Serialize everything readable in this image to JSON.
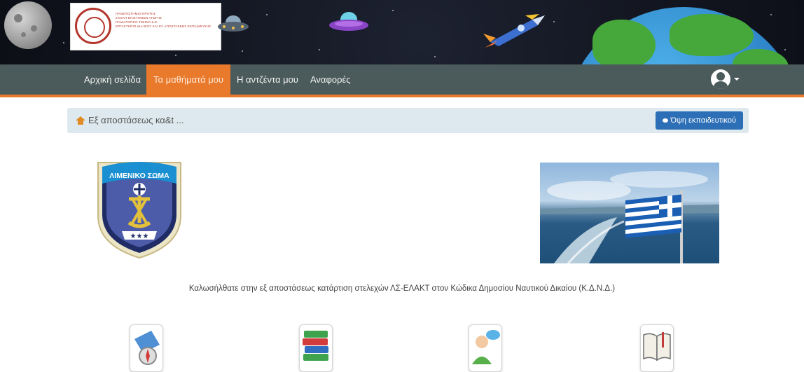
{
  "header": {
    "university_lines": [
      "ΠΑΝΕΠΙΣΤΗΜΙΟ ΚΡΗΤΗΣ",
      "ΣΧΟΛΗ ΕΠΙΣΤΗΜΩΝ ΑΓΩΓΗΣ",
      "ΠΑΙΔΑΓΩΓΙΚΟ ΤΜΗΜΑ Δ.Ε.",
      "ΕΡΓΑΣΤΗΡΙΟ ΔΙΑ ΒΙΟΥ ΚΑΙ ΕΞ ΑΠΟΣΤΑΣΕΩΣ ΕΚΠΑΙΔΕΥΣΗΣ"
    ]
  },
  "nav": {
    "items": [
      {
        "label": "Αρχική σελίδα",
        "active": false
      },
      {
        "label": "Τα μαθήματά μου",
        "active": true
      },
      {
        "label": "Η αντζέντα μου",
        "active": false
      },
      {
        "label": "Αναφορές",
        "active": false
      }
    ],
    "accent_color": "#e97a2c",
    "bar_color": "#4b5a5a"
  },
  "breadcrumb": {
    "text": "Εξ αποστάσεως κα&t ...",
    "teacher_view_label": "Όψη εκπαιδευτικού",
    "home_icon": "home-icon",
    "button_icon": "eye-icon"
  },
  "badge": {
    "text": "ΛΙΜΕΝΙΚΟ ΣΩΜΑ"
  },
  "welcome_text": "Καλωσήλθατε στην εξ αποστάσεως κατάρτιση στελεχών ΛΣ-ΕΛΑΚΤ στον Κώδικα Δημοσίου Ναυτικού Δικαίου (Κ.Δ.Ν.Δ.)",
  "course_icons": [
    "compass-map-icon",
    "books-icon",
    "discussion-user-icon",
    "open-book-icon"
  ]
}
